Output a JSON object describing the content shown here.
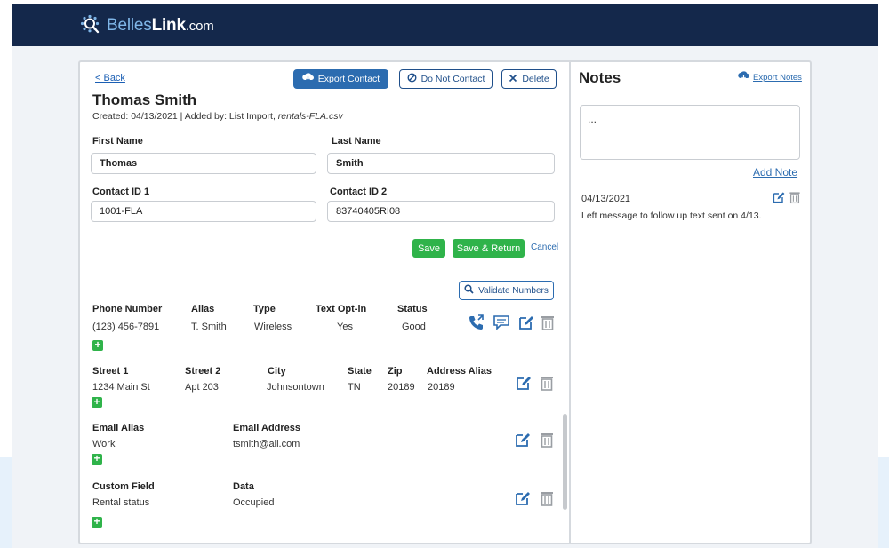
{
  "brand": {
    "part1": "Belles",
    "part2": "Link",
    "part3": ".com"
  },
  "contact": {
    "back_label": "< Back",
    "export_label": "Export Contact",
    "do_not_contact_label": "Do Not Contact",
    "delete_label": "Delete",
    "name": "Thomas Smith",
    "created_prefix": "Created: 04/13/2021  |  Added by: List Import, ",
    "created_file": "rentals-FLA.csv",
    "first_name_label": "First Name",
    "first_name": "Thomas",
    "last_name_label": "Last Name",
    "last_name": "Smith",
    "contact_id1_label": "Contact ID 1",
    "contact_id1": "1001-FLA",
    "contact_id2_label": "Contact ID 2",
    "contact_id2": "83740405RI08",
    "save_label": "Save",
    "save_return_label": "Save & Return",
    "cancel_label": "Cancel",
    "validate_label": "Validate Numbers"
  },
  "phone": {
    "headers": [
      "Phone Number",
      "Alias",
      "Type",
      "Text Opt-in",
      "Status"
    ],
    "row": [
      "(123) 456-7891",
      "T. Smith",
      "Wireless",
      "Yes",
      "Good"
    ]
  },
  "address": {
    "headers": [
      "Street 1",
      "Street 2",
      "City",
      "State",
      "Zip",
      "Address Alias"
    ],
    "row": [
      "1234 Main St",
      "Apt 203",
      "Johnsontown",
      "TN",
      "20189",
      "20189"
    ]
  },
  "email": {
    "headers": [
      "Email Alias",
      "Email Address"
    ],
    "row": [
      "Work",
      "tsmith@ail.com"
    ]
  },
  "custom": {
    "headers": [
      "Custom Field",
      "Data"
    ],
    "row": [
      "Rental status",
      "Occupied"
    ]
  },
  "notes": {
    "title": "Notes",
    "export_label": "Export Notes",
    "input_value": "...",
    "add_label": "Add Note",
    "items": [
      {
        "date": "04/13/2021",
        "text": "Left message to follow up text sent on 4/13."
      }
    ]
  },
  "colors": {
    "navy": "#14284b",
    "accent": "#2c6cb0",
    "green": "#2fb34a"
  }
}
